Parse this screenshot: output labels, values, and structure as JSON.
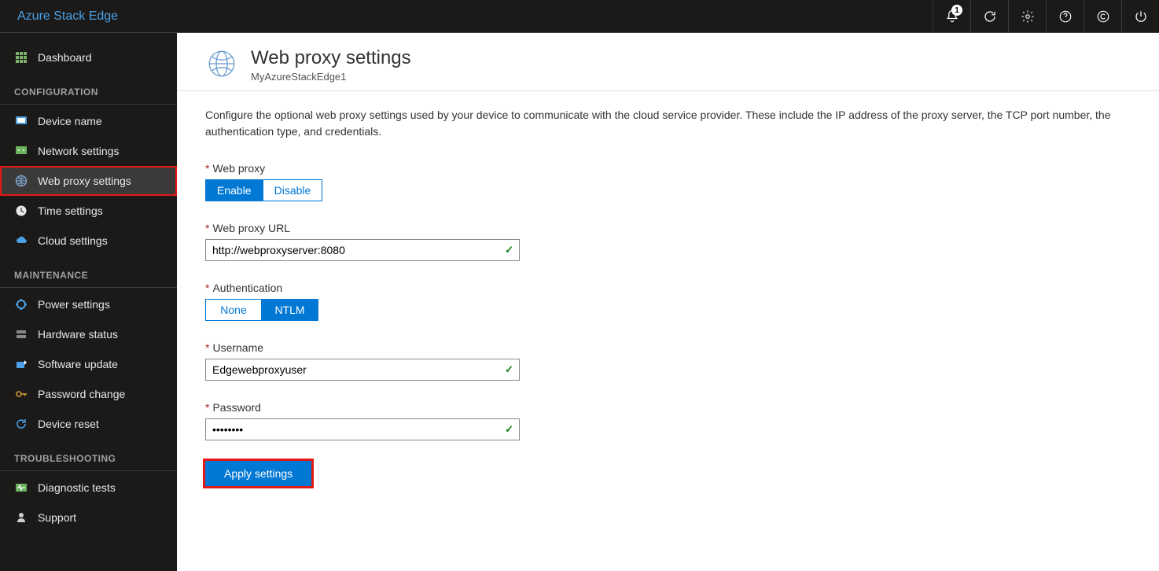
{
  "brand": "Azure Stack Edge",
  "notifications_count": "1",
  "sidebar": {
    "dashboard": "Dashboard",
    "sections": {
      "configuration": "CONFIGURATION",
      "maintenance": "MAINTENANCE",
      "troubleshooting": "TROUBLESHOOTING"
    },
    "items": {
      "device_name": "Device name",
      "network_settings": "Network settings",
      "web_proxy": "Web proxy settings",
      "time_settings": "Time settings",
      "cloud_settings": "Cloud settings",
      "power_settings": "Power settings",
      "hardware_status": "Hardware status",
      "software_update": "Software update",
      "password_change": "Password change",
      "device_reset": "Device reset",
      "diagnostic_tests": "Diagnostic tests",
      "support": "Support"
    }
  },
  "page": {
    "title": "Web proxy settings",
    "subtitle": "MyAzureStackEdge1",
    "description": "Configure the optional web proxy settings used by your device to communicate with the cloud service provider. These include the IP address of the proxy server, the TCP port number, the authentication type, and credentials."
  },
  "form": {
    "web_proxy": {
      "label": "Web proxy",
      "enable": "Enable",
      "disable": "Disable"
    },
    "url": {
      "label": "Web proxy URL",
      "value": "http://webproxyserver:8080"
    },
    "auth": {
      "label": "Authentication",
      "none": "None",
      "ntlm": "NTLM"
    },
    "username": {
      "label": "Username",
      "value": "Edgewebproxyuser"
    },
    "password": {
      "label": "Password",
      "value": "••••••••"
    },
    "apply": "Apply settings"
  }
}
